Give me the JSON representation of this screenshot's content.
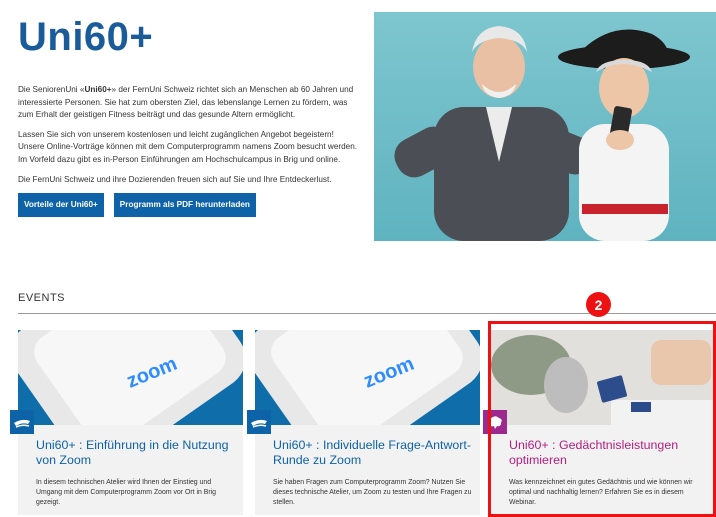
{
  "hero": {
    "brand": "Uni60+",
    "para1_prefix": "Die SeniorenUni «",
    "para1_bold": "Uni60+",
    "para1_suffix": "» der FernUni Schweiz richtet sich an Menschen ab 60 Jahren und interessierte Personen. Sie hat zum obersten Ziel, das lebenslange Lernen zu fördern, was zum Erhalt der geistigen Fitness beiträgt und das gesunde Altern ermöglicht.",
    "para2": "Lassen Sie sich von unserem kostenlosen und leicht zugänglichen Angebot begeistern! Unsere Online-Vorträge können mit dem Computerprogramm namens Zoom besucht werden. Im Vorfeld dazu gibt es in-Person Einführungen am Hochschulcampus in Brig und online.",
    "para3": "Die FernUni Schweiz und ihre Dozierenden freuen sich auf Sie und Ihre Entdeckerlust.",
    "btn_advantages": "Vorteile der Uni60+",
    "btn_pdf": "Programm als PDF herunterladen"
  },
  "events": {
    "heading": "EVENTS",
    "cards": [
      {
        "zoom_word": "zoom",
        "title": "Uni60+ : Einführung in die Nutzung von Zoom",
        "text": "In diesem technischen Atelier wird Ihnen der Einstieg und Umgang mit dem Computerprogramm Zoom vor Ort in Brig gezeigt."
      },
      {
        "zoom_word": "zoom",
        "title": "Uni60+ : Individuelle Frage-Antwort-Runde zu Zoom",
        "text": "Sie haben Fragen zum Computerprogramm Zoom? Nutzen Sie dieses technische Atelier, um Zoom zu testen und Ihre Fragen zu stellen."
      },
      {
        "title": "Uni60+ : Gedächtnisleistungen optimieren",
        "text": "Was kennzeichnet ein gutes Gedächtnis und wie können wir optimal und nachhaltig lernen? Erfahren Sie es in diesem Webinar."
      }
    ]
  },
  "annotation": {
    "badge": "2"
  },
  "icons": {
    "card1_tag": "zoom-tech-tag-icon",
    "card2_tag": "zoom-tech-tag-icon",
    "card3_tag": "brain-tag-icon"
  },
  "colors": {
    "brand_blue": "#1a5c9a",
    "button_blue": "#0e62a8",
    "magenta": "#b3207f",
    "highlight_red": "#ee1111"
  }
}
